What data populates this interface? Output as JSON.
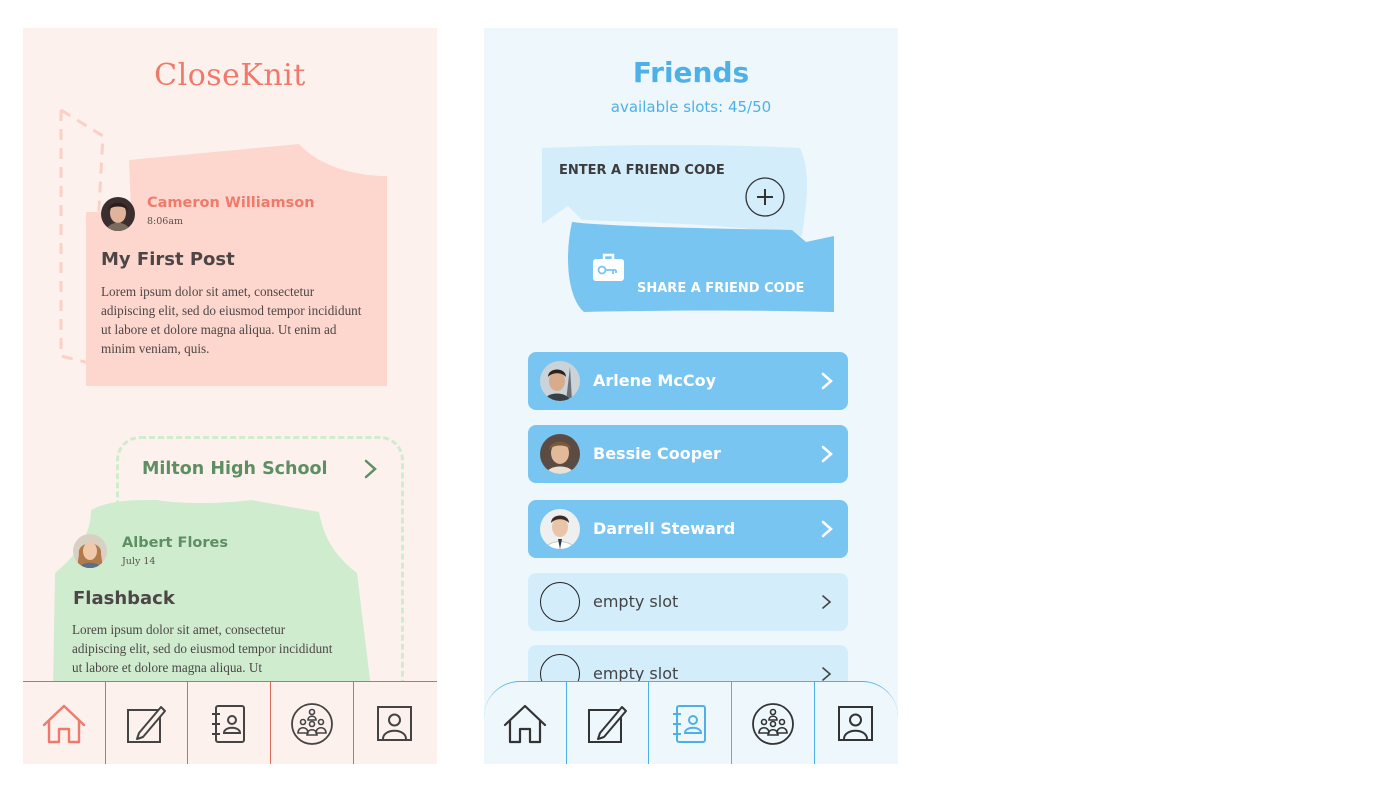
{
  "home": {
    "logo": "CloseKnit",
    "post1": {
      "author": "Cameron Williamson",
      "time": "8:06am",
      "title": "My First Post",
      "body": "Lorem ipsum dolor sit amet, consectetur adipiscing elit, sed do eiusmod tempor incididunt ut labore et dolore magna aliqua. Ut enim ad minim veniam, quis."
    },
    "group": {
      "name": "Milton High School"
    },
    "post2": {
      "author": "Albert Flores",
      "time": "July 14",
      "title": "Flashback",
      "body": "Lorem ipsum dolor sit amet, consectetur adipiscing elit, sed do eiusmod tempor incididunt ut labore et dolore magna aliqua. Ut"
    },
    "nav": {
      "active": "home-icon",
      "icons": [
        "home-icon",
        "pencil-edit-icon",
        "address-book-icon",
        "group-icon",
        "profile-icon"
      ]
    }
  },
  "friends": {
    "title": "Friends",
    "slots_label": "available slots: 45/50",
    "enter_code": "ENTER A FRIEND CODE",
    "share_code": "SHARE A FRIEND CODE",
    "list": [
      {
        "name": "Arlene McCoy",
        "filled": true
      },
      {
        "name": "Bessie Cooper",
        "filled": true
      },
      {
        "name": "Darrell Steward",
        "filled": true
      },
      {
        "name": "empty slot",
        "filled": false
      },
      {
        "name": "empty slot",
        "filled": false
      }
    ],
    "nav": {
      "active": "address-book-icon",
      "icons": [
        "home-icon",
        "pencil-edit-icon",
        "address-book-icon",
        "group-icon",
        "profile-icon"
      ]
    }
  },
  "colors": {
    "coral": "#ef7a6b",
    "coral_bg": "#fdf1ee",
    "post_pink": "#fdd7ce",
    "green": "#5e8f62",
    "post_green": "#cfeccf",
    "sky": "#4db1e8",
    "sky_bg": "#eef7fc",
    "friend_btn": "#78c5f2",
    "empty_btn": "#d4edfb"
  }
}
